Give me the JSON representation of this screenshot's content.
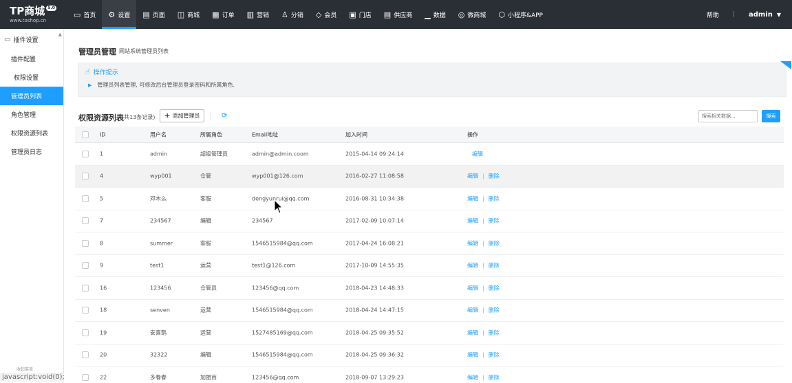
{
  "logo": {
    "name": "TP商城",
    "badge": "5.0",
    "url": "www.toshop.cn"
  },
  "nav": {
    "items": [
      {
        "label": "首页",
        "icon": "monitor-icon"
      },
      {
        "label": "设置",
        "icon": "gear-icon",
        "active": true
      },
      {
        "label": "页面",
        "icon": "page-icon"
      },
      {
        "label": "商城",
        "icon": "shop-icon"
      },
      {
        "label": "订单",
        "icon": "order-icon"
      },
      {
        "label": "营销",
        "icon": "chart-icon"
      },
      {
        "label": "分销",
        "icon": "users-icon"
      },
      {
        "label": "会员",
        "icon": "vip-icon"
      },
      {
        "label": "门店",
        "icon": "store-icon"
      },
      {
        "label": "供应商",
        "icon": "supplier-icon"
      },
      {
        "label": "数据",
        "icon": "data-icon"
      },
      {
        "label": "微商城",
        "icon": "wechat-icon"
      },
      {
        "label": "小程序&APP",
        "icon": "miniapp-icon"
      }
    ],
    "help": "帮助",
    "user": "admin"
  },
  "sidebar": {
    "head": "插件设置",
    "items": [
      {
        "label": "插件配置"
      },
      {
        "label": "权限设置"
      },
      {
        "label": "管理员列表",
        "active": true
      },
      {
        "label": "角色管理"
      },
      {
        "label": "权限资源列表"
      },
      {
        "label": "管理员日志"
      }
    ],
    "status_url": "javascript:void(0);",
    "status_hint": "收起菜单"
  },
  "page": {
    "title": "管理员管理",
    "subtitle": "网站系统管理员列表",
    "tips_title": "操作提示",
    "tips_body": "管理员列表管理, 可修改后台管理员登录密码和所属角色."
  },
  "list": {
    "title": "权限资源列表",
    "count": "(共13条记录)",
    "add_label": "添加管理员",
    "search_placeholder": "搜索相关数据...",
    "search_label": "搜索",
    "columns": {
      "id": "ID",
      "user": "用户名",
      "role": "所属角色",
      "email": "Email地址",
      "time": "加入时间",
      "op": "操作"
    },
    "edit_label": "编辑",
    "delete_label": "删除",
    "rows": [
      {
        "id": "1",
        "user": "admin",
        "role": "超级管理员",
        "email": "admin@admin.coom",
        "time": "2015-04-14 09:24:14"
      },
      {
        "id": "4",
        "user": "wyp001",
        "role": "仓管",
        "email": "wyp001@126.com",
        "time": "2016-02-27 11:08:58"
      },
      {
        "id": "5",
        "user": "邓木么",
        "role": "客服",
        "email": "dengyunrui@qq.com",
        "time": "2016-08-31 10:34:38"
      },
      {
        "id": "7",
        "user": "234567",
        "role": "编辑",
        "email": "234567",
        "time": "2017-02-09 10:07:14"
      },
      {
        "id": "8",
        "user": "summer",
        "role": "客服",
        "email": "1546515984@qq.com",
        "time": "2017-04-24 16:08:21"
      },
      {
        "id": "9",
        "user": "test1",
        "role": "运营",
        "email": "test1@126.com",
        "time": "2017-10-09 14:55:35"
      },
      {
        "id": "16",
        "user": "123456",
        "role": "仓管员",
        "email": "123456@qq.com",
        "time": "2018-04-23 14:48:33"
      },
      {
        "id": "18",
        "user": "senven",
        "role": "运营",
        "email": "1546515984@qq.com",
        "time": "2018-04-24 14:47:15"
      },
      {
        "id": "19",
        "user": "安喜鹊",
        "role": "运营",
        "email": "1527485169@qq.com",
        "time": "2018-04-25 09:35:52"
      },
      {
        "id": "20",
        "user": "32322",
        "role": "编辑",
        "email": "1546515984@qq.com",
        "time": "2018-04-25 09:36:32"
      },
      {
        "id": "22",
        "user": "多春春",
        "role": "加盟商",
        "email": "123456@qq.com",
        "time": "2018-09-07 13:29:23"
      }
    ]
  },
  "colors": {
    "accent": "#1e9fff",
    "topbar": "#2a2e35"
  }
}
